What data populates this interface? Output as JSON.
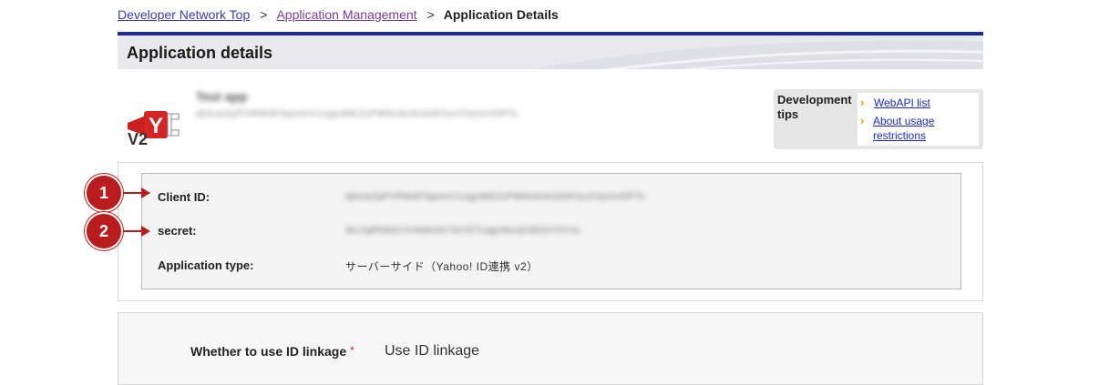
{
  "breadcrumb": {
    "items": [
      "Developer Network Top",
      "Application Management"
    ],
    "separator": ">",
    "current": "Application Details"
  },
  "page_title": "Application details",
  "app": {
    "name": "Test app",
    "key": "dj0zaiZpPVRWdFNpemV1cjgxWEZzPWNvbnN1bWVyc2VjcmV0PTc",
    "version_badge": "V2",
    "logo_icon": "yahoo-connect-plug-icon"
  },
  "tips": {
    "label": "Development tips",
    "links": [
      "WebAPI list",
      "About usage restrictions"
    ]
  },
  "details": {
    "client_id": {
      "label": "Client ID:",
      "value": "dj0zaiZpPVRWdFNpemV1cjgxWEZzPWNvbnN1bWVyc2VjcmV0PTc"
    },
    "secret": {
      "label": "secret:",
      "value": "WLXgRhM2cVnNdmHLTktYETuqgVAmQrdDZeYhYxL"
    },
    "app_type": {
      "label": "Application type:",
      "value": "サーバーサイド（Yahoo! ID連携 v2）"
    }
  },
  "markers": [
    "1",
    "2"
  ],
  "linkage": {
    "label": "Whether to use ID linkage",
    "required_mark": "*",
    "value": "Use ID linkage"
  },
  "colors": {
    "accent_bar": "#1d2a9e",
    "marker": "#b81c1c",
    "link": "#3c3cb4",
    "tip_chevron": "#f0a000"
  }
}
